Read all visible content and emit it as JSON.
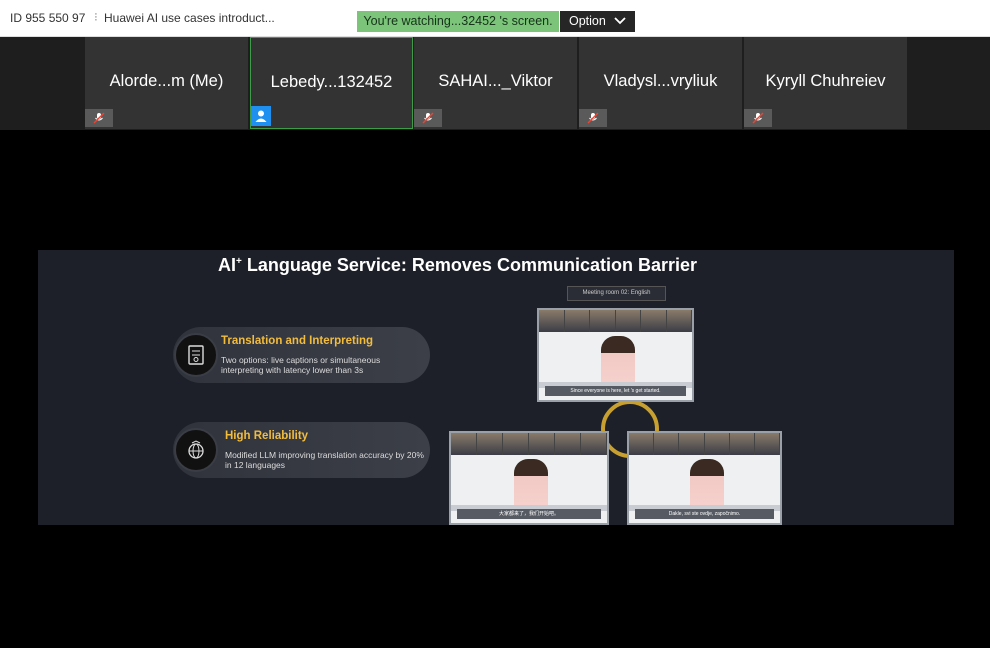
{
  "topbar": {
    "meeting_id": "ID 955 550 97",
    "separator": "⁝",
    "meeting_title": "Huawei AI use cases introduct...",
    "watching_text": "You're watching...32452 's screen.",
    "option_label": "Option"
  },
  "participants": [
    {
      "name": "Alorde...m (Me)",
      "badge": "mic-muted-icon"
    },
    {
      "name": "Lebedy...132452",
      "badge": "user-icon",
      "active": true
    },
    {
      "name": "SAHAI..._Viktor",
      "badge": "mic-muted-icon"
    },
    {
      "name": "Vladysl...vryliuk",
      "badge": "mic-muted-icon"
    },
    {
      "name": "Kyryll Chuhreiev",
      "badge": "mic-muted-icon"
    }
  ],
  "slide": {
    "title_main": "AI",
    "title_sup": "+",
    "title_rest": " Language Service: Removes Communication Barrier",
    "items": [
      {
        "title": "Translation and Interpreting",
        "desc": "Two options: live captions or simultaneous interpreting with latency lower than 3s",
        "icon": "document-icon"
      },
      {
        "title": "High Reliability",
        "desc": "Modified LLM improving translation accuracy by 20% in 12 languages",
        "icon": "globe-icon"
      }
    ],
    "room_label": "Meeting room 02: English",
    "captions": [
      "Since everyone is here, let 's get started.",
      "大家都来了，我们开始吧。",
      "Dakle, svi ste ovdje, započnimo."
    ]
  },
  "colors": {
    "accent_green": "#7cc47a",
    "active_border": "#3e9b48",
    "title_gold": "#f3bd3b"
  }
}
